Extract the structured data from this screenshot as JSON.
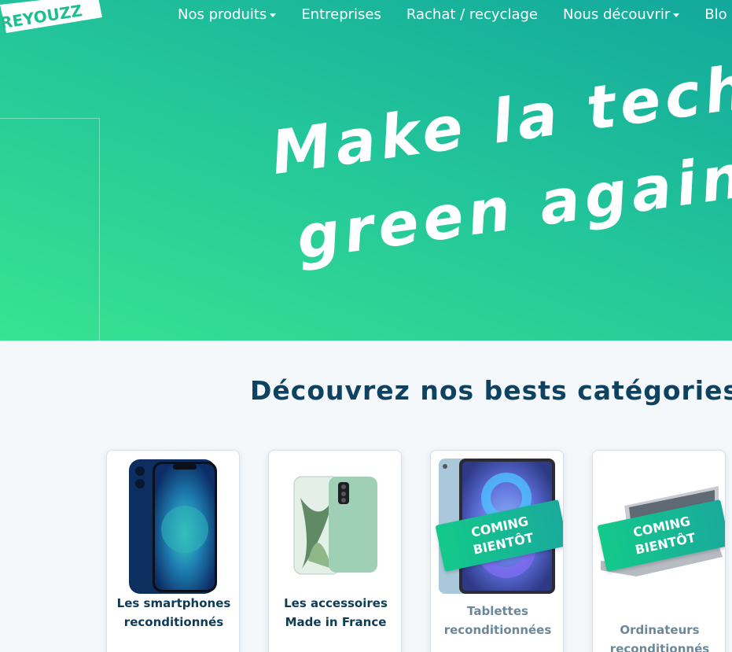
{
  "brand": {
    "logo_text": "REYOUZZ"
  },
  "nav": {
    "items": [
      {
        "label": "Nos produits",
        "dropdown": true
      },
      {
        "label": "Entreprises",
        "dropdown": false
      },
      {
        "label": "Rachat / recyclage",
        "dropdown": false
      },
      {
        "label": "Nous découvrir",
        "dropdown": true
      },
      {
        "label": "Blo",
        "dropdown": false
      }
    ]
  },
  "hero": {
    "line1": "Make la tech",
    "line2": "green again",
    "colors": {
      "start": "#38e391",
      "end": "#12a89c"
    }
  },
  "categories": {
    "title": "Découvrez nos bests catégories",
    "cards": [
      {
        "label": "Les smartphones reconditionnés",
        "coming_soon": false
      },
      {
        "label": "Les accessoires Made in France",
        "coming_soon": false
      },
      {
        "label": "Tablettes reconditionnées",
        "coming_soon": true,
        "badge": "COMING BIENTÔT"
      },
      {
        "label": "Ordinateurs reconditionnés",
        "coming_soon": true,
        "badge": "COMING BIENTÔT"
      }
    ]
  },
  "badge_lines": [
    "COMING",
    "BIENTÔT"
  ],
  "accent": "#0e4260"
}
